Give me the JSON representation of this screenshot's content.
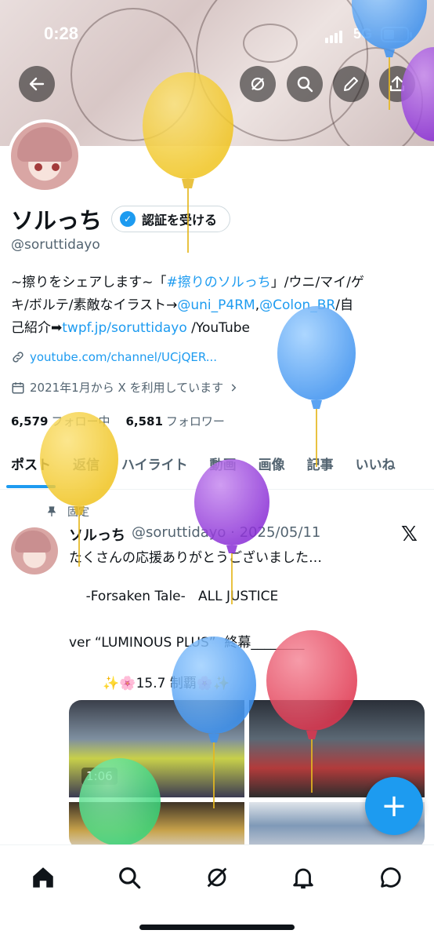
{
  "status": {
    "time": "0:28",
    "network": "5G"
  },
  "profile": {
    "name": "ソルっち",
    "verify_label": "認証を受ける",
    "handle": "@soruttidayo",
    "bio_1": "~擦りをシェアします~「",
    "bio_hashtag": "#擦りのソルっち",
    "bio_2": "」/ウニ/マイ/ゲ",
    "bio_3": "キ/ボルテ/素敵なイラスト→",
    "bio_mention1": "@uni_P4RM",
    "bio_comma": ",",
    "bio_mention2": "@Colon_BR",
    "bio_4": "/自",
    "bio_5": "己紹介➡",
    "bio_link": "twpf.jp/soruttidayo",
    "bio_6": " /YouTube",
    "website": "youtube.com/channel/UCjQER...",
    "joined": "2021年1月から X を利用しています",
    "following_count": "6,579",
    "following_label": "フォロー中",
    "followers_count": "6,581",
    "followers_label": "フォロワー"
  },
  "tabs": [
    "ポスト",
    "返信",
    "ハイライト",
    "動画",
    "画像",
    "記事",
    "いいね"
  ],
  "post": {
    "pinned_label": "固定",
    "author": "ソルっち",
    "meta": "@soruttidayo · 2025/05/11",
    "line1": "たくさんの応援ありがとうございました…",
    "line2": "    -Forsaken Tale-   ALL JUSTICE",
    "line3": "ver “LUMINOUS PLUS”  終幕________",
    "line4": "        ✨🌸15.7 制覇🌸✨",
    "video_duration": "1:06"
  },
  "fab_label": "+",
  "icons": {
    "back": "back-arrow-icon",
    "grok": "grok-icon",
    "search": "search-icon",
    "edit": "pencil-icon",
    "share": "share-icon"
  },
  "colors": {
    "accent": "#1d9bf0"
  }
}
